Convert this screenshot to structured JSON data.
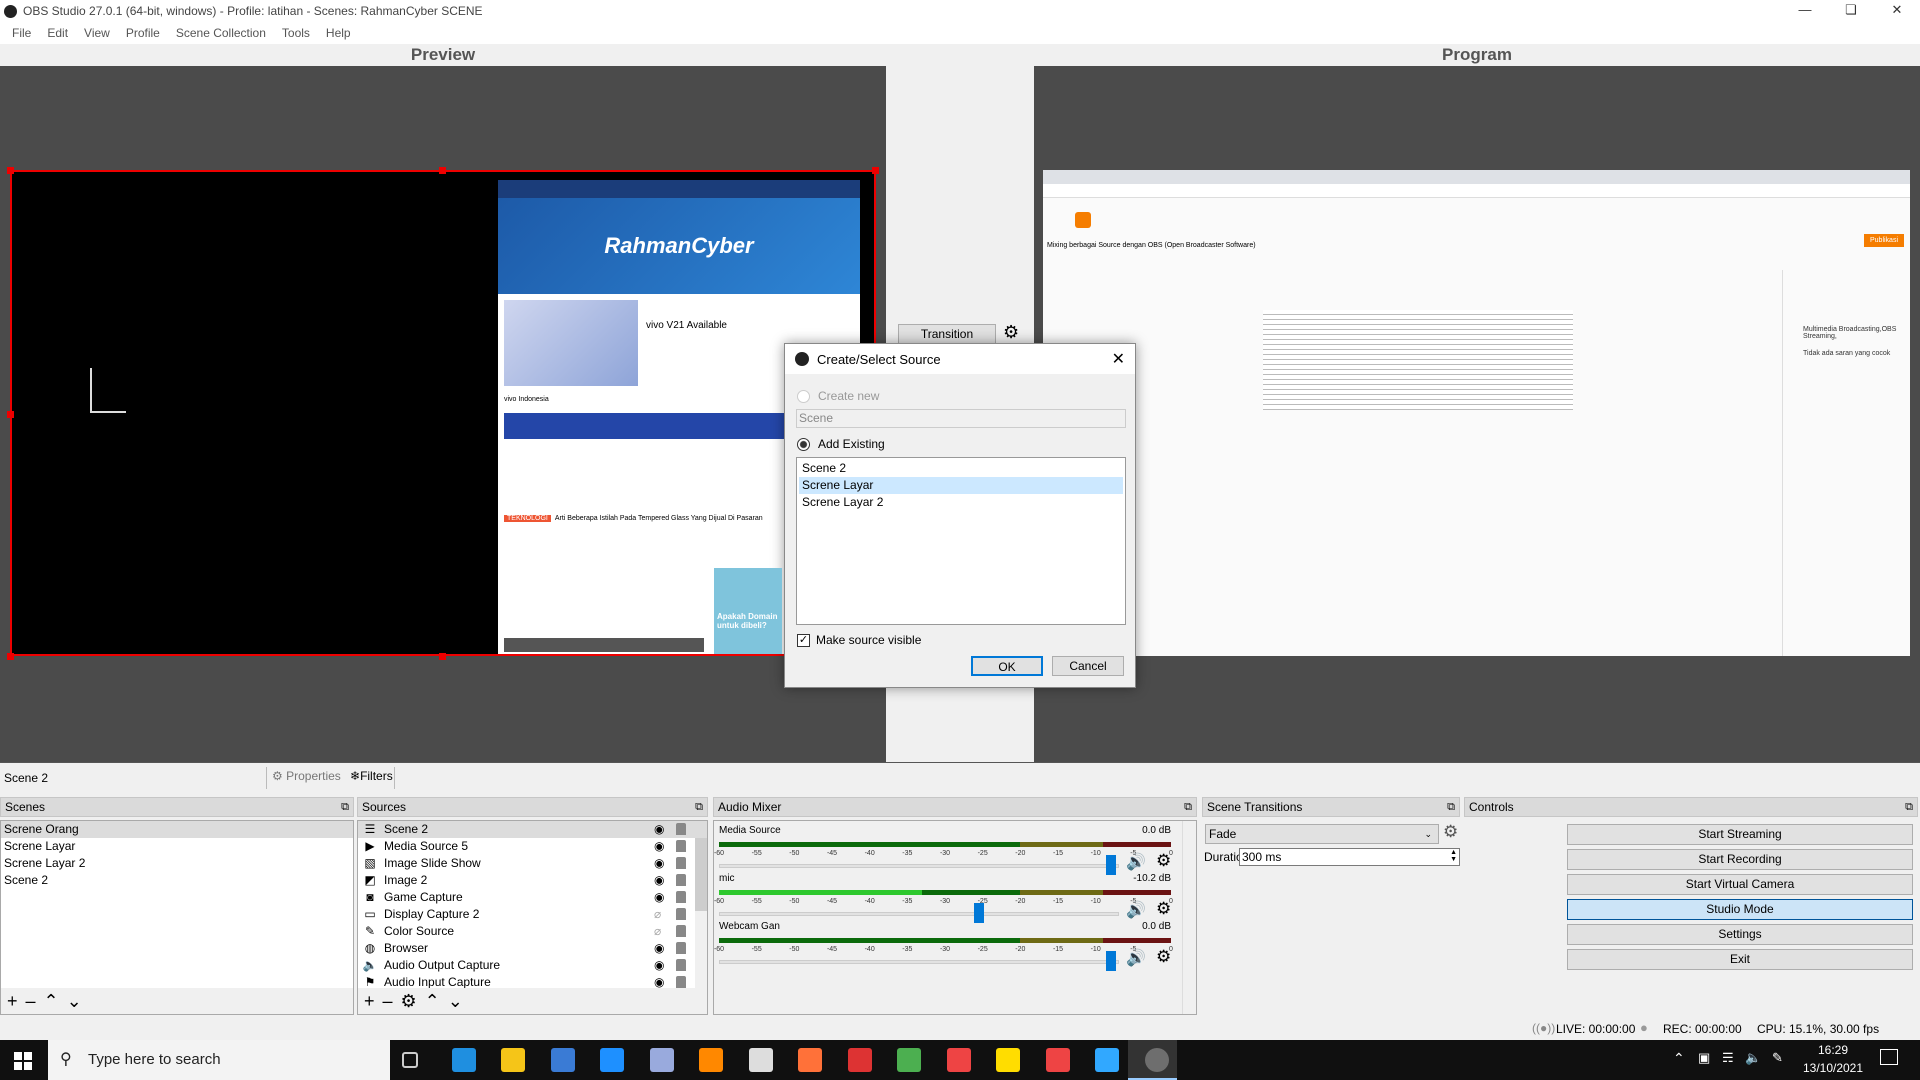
{
  "window": {
    "title": "OBS Studio 27.0.1 (64-bit, windows) - Profile: latihan - Scenes: RahmanCyber SCENE"
  },
  "menu": [
    "File",
    "Edit",
    "View",
    "Profile",
    "Scene Collection",
    "Tools",
    "Help"
  ],
  "preview": {
    "label": "Preview",
    "site_logo": "RahmanCyber",
    "ad_text": "vivo V21 Available",
    "ad_brand": "vivo Indonesia",
    "news_tag": "TEKNOLOGI",
    "news_text": "Arti Beberapa Istilah Pada Tempered Glass Yang Dijual Di Pasaran",
    "blogger_card": "Apakah Domain untuk dibeli?"
  },
  "program": {
    "label": "Program",
    "post_title": "Mixing berbagai Source dengan OBS (Open Broadcaster Software)",
    "publish": "Publikasi",
    "labels_text": "Multimedia Broadcasting,OBS Streaming,",
    "no_suggestion": "Tidak ada saran yang cocok"
  },
  "transition": {
    "button": "Transition"
  },
  "dialog": {
    "title": "Create/Select Source",
    "create_new": "Create new",
    "name_value": "Scene",
    "add_existing": "Add Existing",
    "items": [
      "Scene 2",
      "Screne Layar",
      "Screne Layar 2"
    ],
    "selected_index": 1,
    "make_visible": "Make source visible",
    "make_visible_checked": true,
    "ok": "OK",
    "cancel": "Cancel"
  },
  "context": {
    "current": "Scene 2",
    "properties": "Properties",
    "filters": "Filters"
  },
  "scenes": {
    "title": "Scenes",
    "items": [
      "Screne Orang",
      "Screne Layar",
      "Screne Layar 2",
      "Scene 2"
    ],
    "selected_index": 0
  },
  "sources": {
    "title": "Sources",
    "items": [
      {
        "name": "Scene 2",
        "icon": "list-icon",
        "visible": true
      },
      {
        "name": "Media Source 5",
        "icon": "play-icon",
        "visible": true
      },
      {
        "name": "Image Slide Show",
        "icon": "slideshow-icon",
        "visible": true
      },
      {
        "name": "Image 2",
        "icon": "image-icon",
        "visible": true
      },
      {
        "name": "Game Capture",
        "icon": "gamepad-icon",
        "visible": true
      },
      {
        "name": "Display Capture 2",
        "icon": "monitor-icon",
        "visible": false
      },
      {
        "name": "Color Source",
        "icon": "brush-icon",
        "visible": false
      },
      {
        "name": "Browser",
        "icon": "globe-icon",
        "visible": true
      },
      {
        "name": "Audio Output Capture",
        "icon": "speaker-icon",
        "visible": true
      },
      {
        "name": "Audio Input Capture",
        "icon": "microphone-icon",
        "visible": true
      }
    ]
  },
  "audio": {
    "title": "Audio Mixer",
    "ticks": [
      "-60",
      "-55",
      "-50",
      "-45",
      "-40",
      "-35",
      "-30",
      "-25",
      "-20",
      "-15",
      "-10",
      "-5",
      "0"
    ],
    "channels": [
      {
        "name": "Media Source",
        "db": "0.0 dB",
        "fader": 0.98,
        "level_db": -60
      },
      {
        "name": "mic",
        "db": "-10.2 dB",
        "fader": 0.65,
        "level_db": -33
      },
      {
        "name": "Webcam Gan",
        "db": "0.0 dB",
        "fader": 0.98,
        "level_db": -60
      }
    ]
  },
  "transitions": {
    "title": "Scene Transitions",
    "selected": "Fade",
    "duration_label": "Duration",
    "duration_value": "300 ms"
  },
  "controls": {
    "title": "Controls",
    "buttons": [
      "Start Streaming",
      "Start Recording",
      "Start Virtual Camera",
      "Studio Mode",
      "Settings",
      "Exit"
    ],
    "active_index": 3
  },
  "status": {
    "live": "LIVE: 00:00:00",
    "rec": "REC: 00:00:00",
    "cpu": "CPU: 15.1%, 30.00 fps"
  },
  "taskbar": {
    "search_placeholder": "Type here to search",
    "time": "16:29",
    "date": "13/10/2021",
    "apps": [
      "task-view",
      "edge",
      "file-explorer",
      "store",
      "mail",
      "notepad",
      "vlc",
      "calendar",
      "firefox",
      "media-player",
      "chrome",
      "paint",
      "sticky-notes",
      "chrome-2",
      "photoshop",
      "obs"
    ]
  },
  "colors": {
    "accent": "#0078d7",
    "selection": "#cce8ff",
    "bounding": "#ee0000"
  }
}
